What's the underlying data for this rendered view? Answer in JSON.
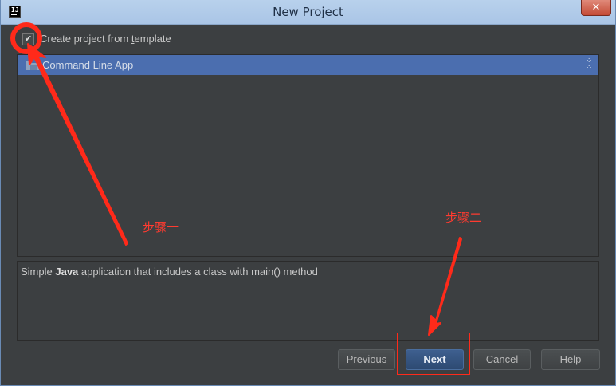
{
  "window": {
    "title": "New Project",
    "app_icon_text": "IJ",
    "close_glyph": "✕"
  },
  "template_checkbox": {
    "label_prefix": "Create project from ",
    "label_underlined": "t",
    "label_suffix": "emplate",
    "checked": true,
    "check_glyph": "✔"
  },
  "template_list": {
    "items": [
      {
        "label": "Command Line App",
        "selected": true
      }
    ]
  },
  "description": {
    "prefix": "Simple ",
    "bold": "Java",
    "suffix": " application that includes a class with main() method"
  },
  "buttons": {
    "previous": {
      "underlined": "P",
      "rest": "revious"
    },
    "next": {
      "underlined": "N",
      "rest": "ext"
    },
    "cancel": "Cancel",
    "help": "Help"
  },
  "annotations": {
    "step1": "步骤一",
    "step2": "步骤二"
  },
  "colors": {
    "background": "#3c3f41",
    "selection": "#4b6eaf",
    "annotation": "#ff3b30",
    "titlebar": "#aac5e6"
  }
}
